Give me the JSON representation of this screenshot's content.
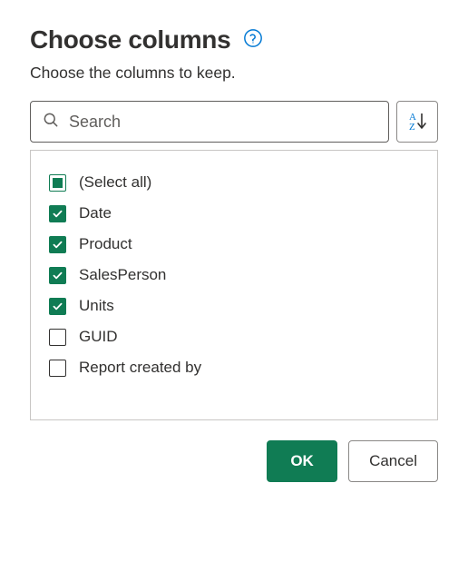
{
  "dialog": {
    "title": "Choose columns",
    "subtitle": "Choose the columns to keep."
  },
  "search": {
    "placeholder": "Search",
    "value": ""
  },
  "columns": {
    "select_all_label": "(Select all)",
    "select_all_state": "indeterminate",
    "items": [
      {
        "label": "Date",
        "checked": true
      },
      {
        "label": "Product",
        "checked": true
      },
      {
        "label": "SalesPerson",
        "checked": true
      },
      {
        "label": "Units",
        "checked": true
      },
      {
        "label": "GUID",
        "checked": false
      },
      {
        "label": "Report created by",
        "checked": false
      }
    ]
  },
  "buttons": {
    "ok": "OK",
    "cancel": "Cancel"
  },
  "colors": {
    "accent": "#107c54",
    "help_icon": "#0078d4"
  }
}
